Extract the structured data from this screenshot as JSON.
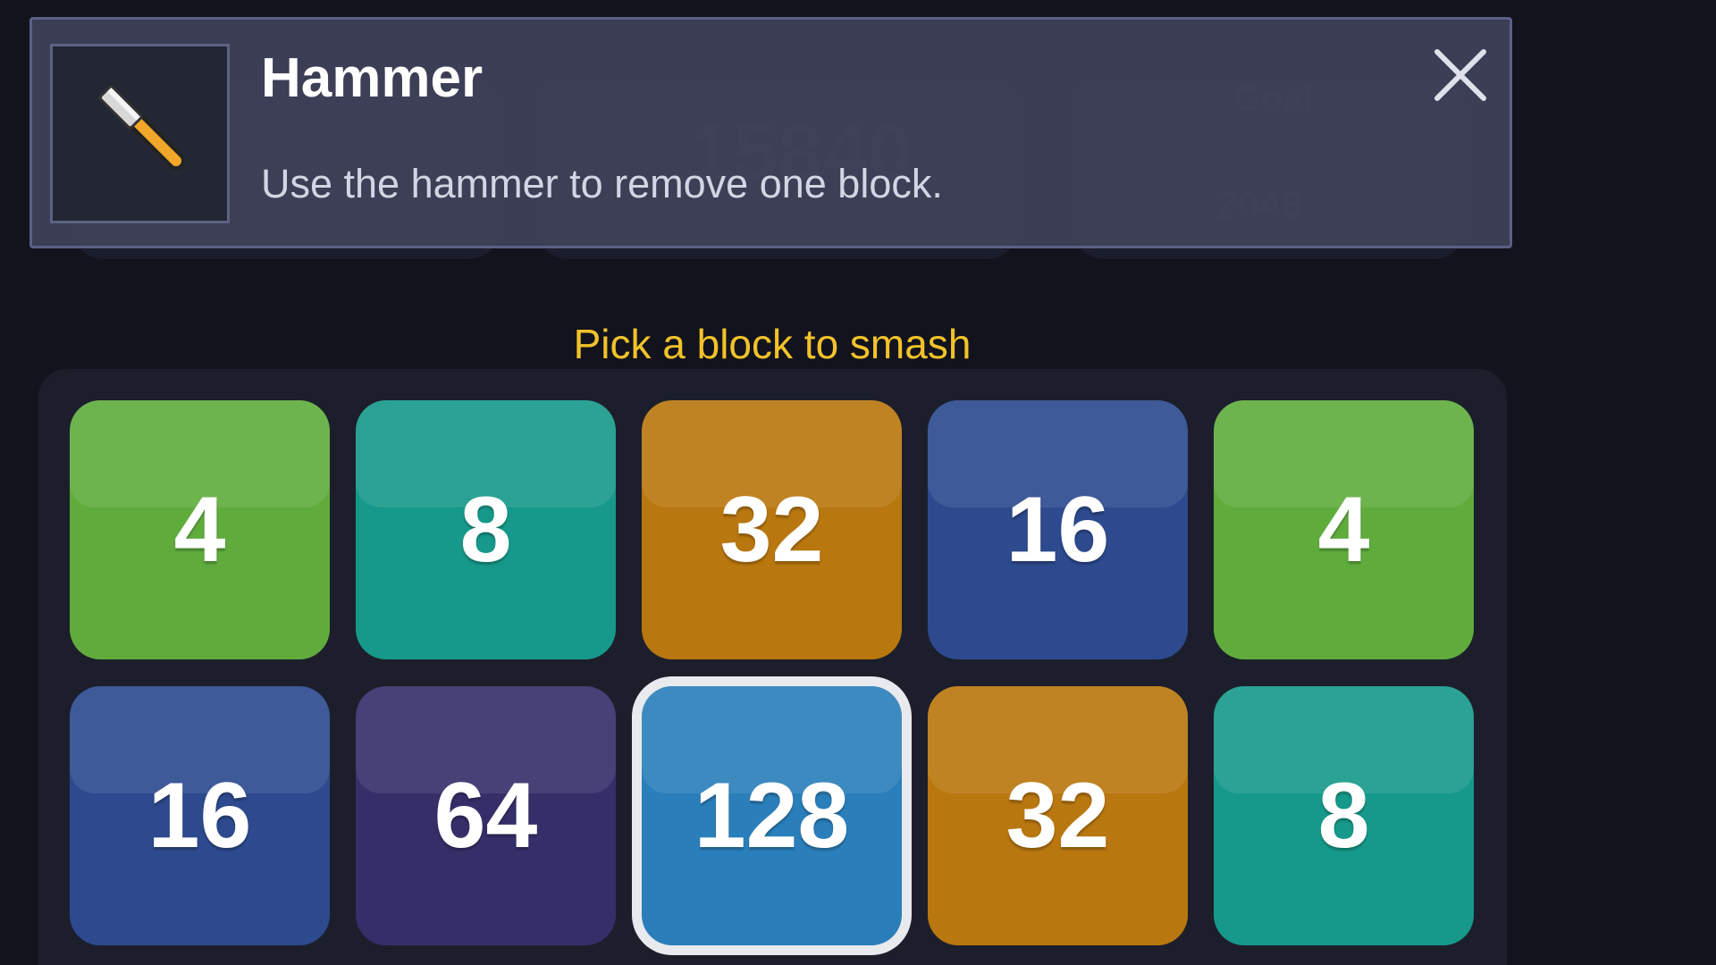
{
  "banner": {
    "title": "Hammer",
    "description": "Use the hammer to remove one block.",
    "icon": "hammer-icon",
    "close_icon": "close-icon"
  },
  "background_stats": {
    "score": "15840",
    "best_label": "Goal",
    "best_value": "2048"
  },
  "hint": "Pick a block to smash",
  "colors": {
    "4": "#5fac3d",
    "8": "#16998a",
    "16": "#2d4a8e",
    "32": "#b9770f",
    "64": "#342f69",
    "128": "#2a7fba",
    "hint": "#f2c22a",
    "selection_ring": "#e8eaee"
  },
  "grid": {
    "rows": [
      [
        {
          "value": "4",
          "color": "#5fac3d"
        },
        {
          "value": "8",
          "color": "#16998a"
        },
        {
          "value": "32",
          "color": "#b9770f"
        },
        {
          "value": "16",
          "color": "#2d4a8e"
        },
        {
          "value": "4",
          "color": "#5fac3d"
        }
      ],
      [
        {
          "value": "16",
          "color": "#2d4a8e"
        },
        {
          "value": "64",
          "color": "#342f69"
        },
        {
          "value": "128",
          "color": "#2a7fba",
          "selected": true
        },
        {
          "value": "32",
          "color": "#b9770f"
        },
        {
          "value": "8",
          "color": "#16998a"
        }
      ]
    ]
  }
}
